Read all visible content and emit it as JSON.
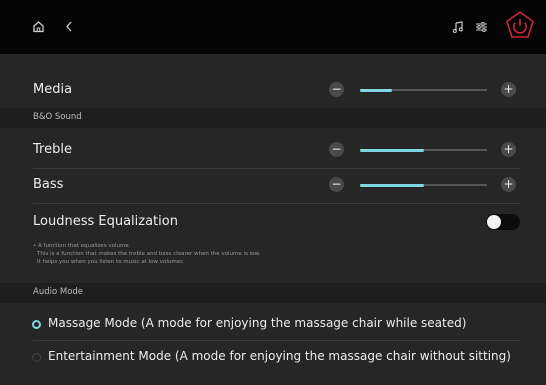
{
  "topbar": {
    "home_icon": "home-icon",
    "back_icon": "chevron-left-icon",
    "music_icon": "music-note-icon",
    "settings_icon": "sliders-icon",
    "power_icon": "power-icon",
    "power_color": "#c8283a"
  },
  "media": {
    "label": "Media",
    "level": 0.25
  },
  "bo_sound": {
    "section_label": "B&O Sound",
    "treble": {
      "label": "Treble",
      "level": 0.5
    },
    "bass": {
      "label": "Bass",
      "level": 0.5
    },
    "loudness": {
      "label": "Loudness Equalization",
      "enabled": false,
      "note_lines": [
        "• A function that equalizes volume",
        "This is a function that makes the treble and bass clearer when the volume is low.",
        "It helps you when you listen to music at low volumes"
      ]
    }
  },
  "audio_mode": {
    "section_label": "Audio Mode",
    "options": [
      {
        "label": "Massage Mode (A mode for enjoying the massage chair while seated)",
        "selected": true
      },
      {
        "label": "Entertainment Mode (A mode for enjoying the massage chair without sitting)",
        "selected": false
      }
    ]
  },
  "colors": {
    "accent": "#7fd6e2",
    "background": "#262626",
    "topbar": "#050505"
  }
}
